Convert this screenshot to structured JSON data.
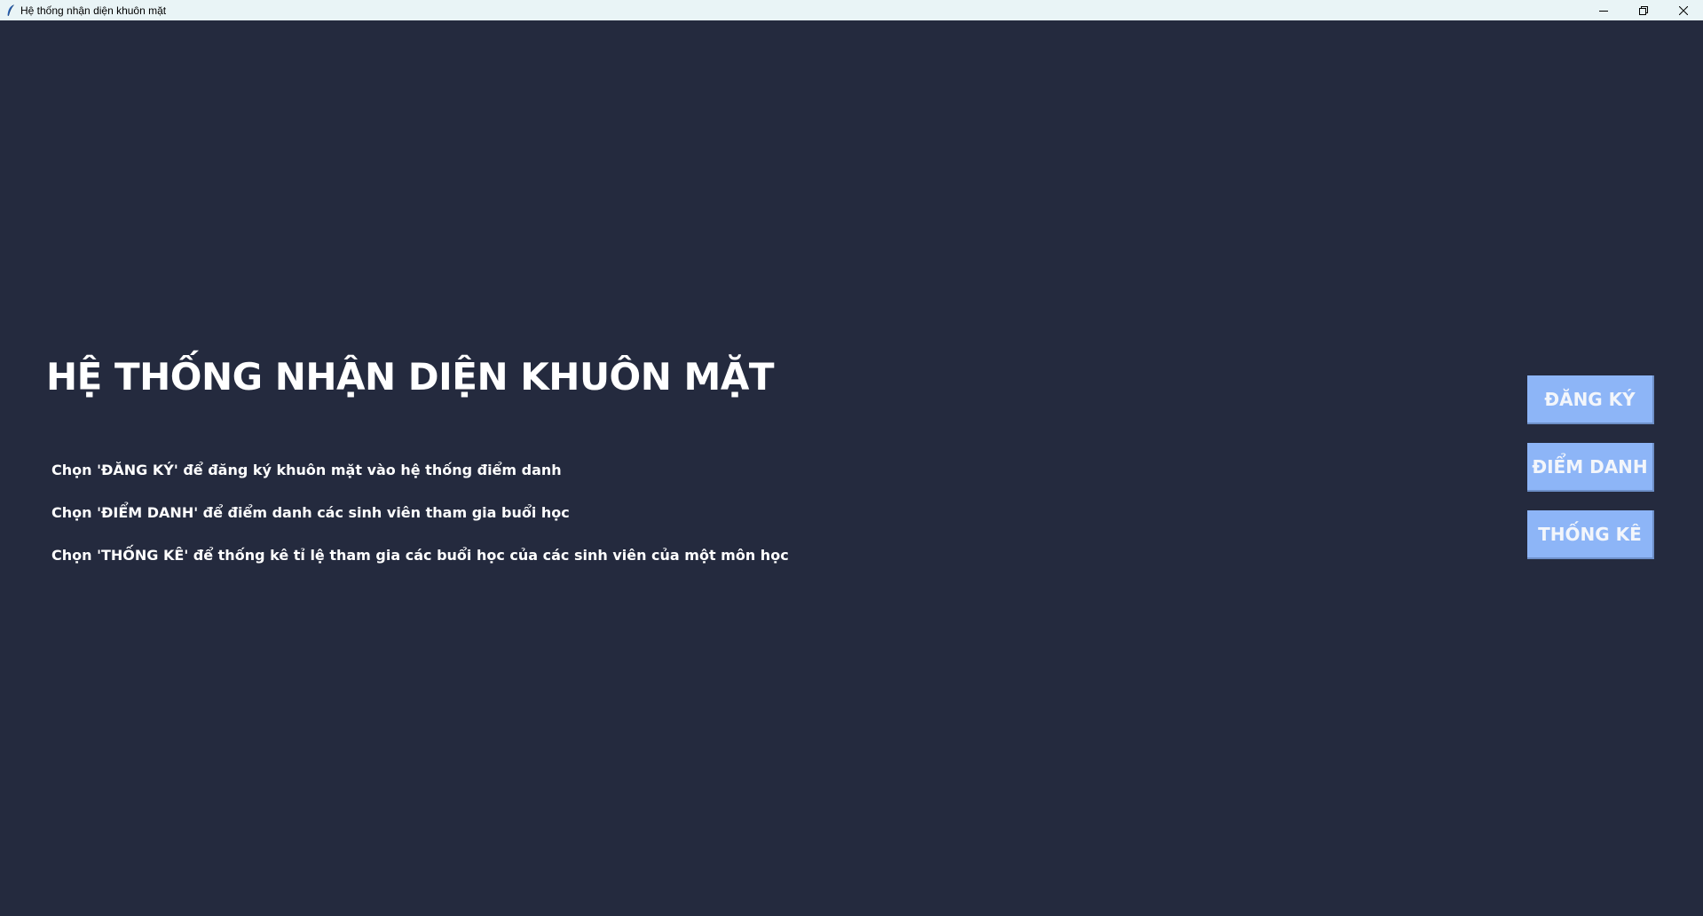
{
  "window": {
    "title": "Hệ thống nhận diện khuôn mặt"
  },
  "main": {
    "heading": "HỆ THỐNG NHẬN DIỆN KHUÔN MẶT",
    "instructions": [
      "Chọn 'ĐĂNG KÝ' để đăng ký khuôn mặt vào hệ thống điểm danh",
      "Chọn 'ĐIỂM DANH' để điểm danh các sinh viên tham gia buổi học",
      "Chọn 'THỐNG KÊ' để thống kê tỉ lệ tham gia các buổi học của các sinh viên của một môn học"
    ]
  },
  "actions": {
    "register_label": "ĐĂNG KÝ",
    "attendance_label": "ĐIỂM DANH",
    "stats_label": "THỐNG KÊ"
  },
  "icons": {
    "app": "feather-icon",
    "minimize": "minimize-icon",
    "restore": "restore-icon",
    "close": "close-icon"
  },
  "colors": {
    "background": "#242a3e",
    "titlebar": "#e9f4f6",
    "button": "#8db5f7",
    "text": "#ffffff"
  }
}
